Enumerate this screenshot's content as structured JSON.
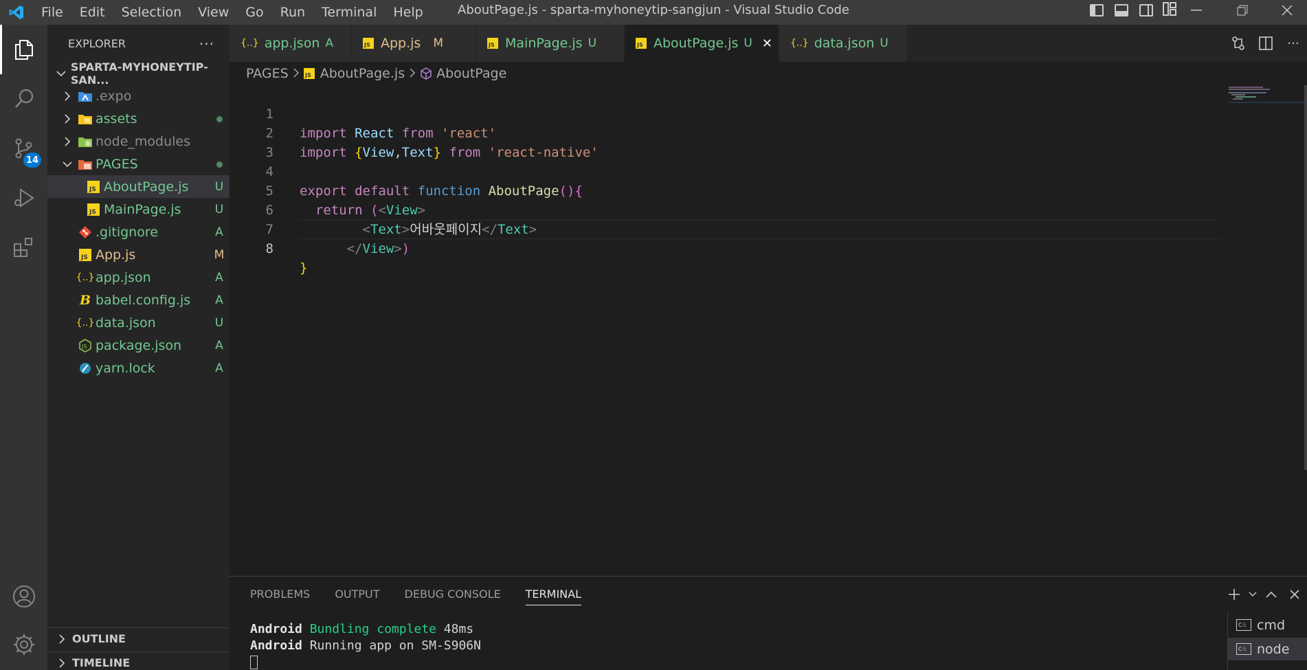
{
  "window": {
    "title": "AboutPage.js - sparta-myhoneytip-sangjun - Visual Studio Code",
    "menu": [
      "File",
      "Edit",
      "Selection",
      "View",
      "Go",
      "Run",
      "Terminal",
      "Help"
    ]
  },
  "activity": {
    "scm_badge": "14"
  },
  "sidebar": {
    "title": "EXPLORER",
    "more": "···",
    "root": "SPARTA-MYHONEYTIP-SAN...",
    "items": [
      {
        "label": ".expo",
        "status": "",
        "icon": "expo-folder-icon"
      },
      {
        "label": "assets",
        "status": "dot",
        "icon": "assets-folder-icon"
      },
      {
        "label": "node_modules",
        "status": "",
        "icon": "node-folder-icon"
      },
      {
        "label": "PAGES",
        "status": "dot",
        "icon": "pages-folder-icon"
      },
      {
        "label": "AboutPage.js",
        "status": "U",
        "icon": "js-file-icon"
      },
      {
        "label": "MainPage.js",
        "status": "U",
        "icon": "js-file-icon"
      },
      {
        "label": ".gitignore",
        "status": "A",
        "icon": "git-icon"
      },
      {
        "label": "App.js",
        "status": "M",
        "icon": "js-file-icon"
      },
      {
        "label": "app.json",
        "status": "A",
        "icon": "json-icon"
      },
      {
        "label": "babel.config.js",
        "status": "A",
        "icon": "babel-icon"
      },
      {
        "label": "data.json",
        "status": "U",
        "icon": "json-icon"
      },
      {
        "label": "package.json",
        "status": "A",
        "icon": "node-icon"
      },
      {
        "label": "yarn.lock",
        "status": "A",
        "icon": "yarn-icon"
      }
    ],
    "outline": "OUTLINE",
    "timeline": "TIMELINE"
  },
  "tabs": [
    {
      "label": "app.json",
      "status": "A",
      "icon": "{..}"
    },
    {
      "label": "App.js",
      "status": "M",
      "icon": "JS"
    },
    {
      "label": "MainPage.js",
      "status": "U",
      "icon": "JS"
    },
    {
      "label": "AboutPage.js",
      "status": "U",
      "icon": "JS",
      "close": "✕"
    },
    {
      "label": "data.json",
      "status": "U",
      "icon": "{..}"
    }
  ],
  "breadcrumb": {
    "folder": "PAGES",
    "file": "AboutPage.js",
    "symbol": "AboutPage"
  },
  "code": {
    "line_numbers": [
      "1",
      "2",
      "3",
      "4",
      "5",
      "6",
      "7",
      "8"
    ],
    "l1": {
      "kw": "import",
      "id": "React",
      "from": "from",
      "str": "'react'"
    },
    "l2": {
      "kw": "import",
      "ob": "{",
      "id1": "View",
      "comma": ",",
      "id2": "Text",
      "cb": "}",
      "from": "from",
      "str": "'react-native'"
    },
    "l4": {
      "export": "export",
      "default": "default",
      "function": "function",
      "name": "AboutPage",
      "parens": "()",
      "ob": "{"
    },
    "l5": {
      "return": "return",
      "paren": "(",
      "lt": "<",
      "tag": "View",
      "gt": ">"
    },
    "l6": {
      "lt": "<",
      "tag": "Text",
      "gt": ">",
      "text": "어바웃페이지",
      "close_lt": "</",
      "close_tag": "Text",
      "close_gt": ">"
    },
    "l7": {
      "close_lt": "</",
      "tag": "View",
      "gt": ">",
      "paren": ")"
    },
    "l8": {
      "cb": "}"
    }
  },
  "panel": {
    "tabs": [
      "PROBLEMS",
      "OUTPUT",
      "DEBUG CONSOLE",
      "TERMINAL"
    ],
    "terminal_lines": [
      {
        "prefix": "Android",
        "msg": "Bundling complete",
        "time": "48ms"
      },
      {
        "prefix": "Android",
        "msg": "Running app on SM-S906N"
      }
    ],
    "terminals": [
      "cmd",
      "node"
    ],
    "term_icon": "C:\\"
  },
  "colors": {
    "accent": "#0078d4",
    "untracked": "#73c991",
    "modified": "#e2c08d"
  }
}
